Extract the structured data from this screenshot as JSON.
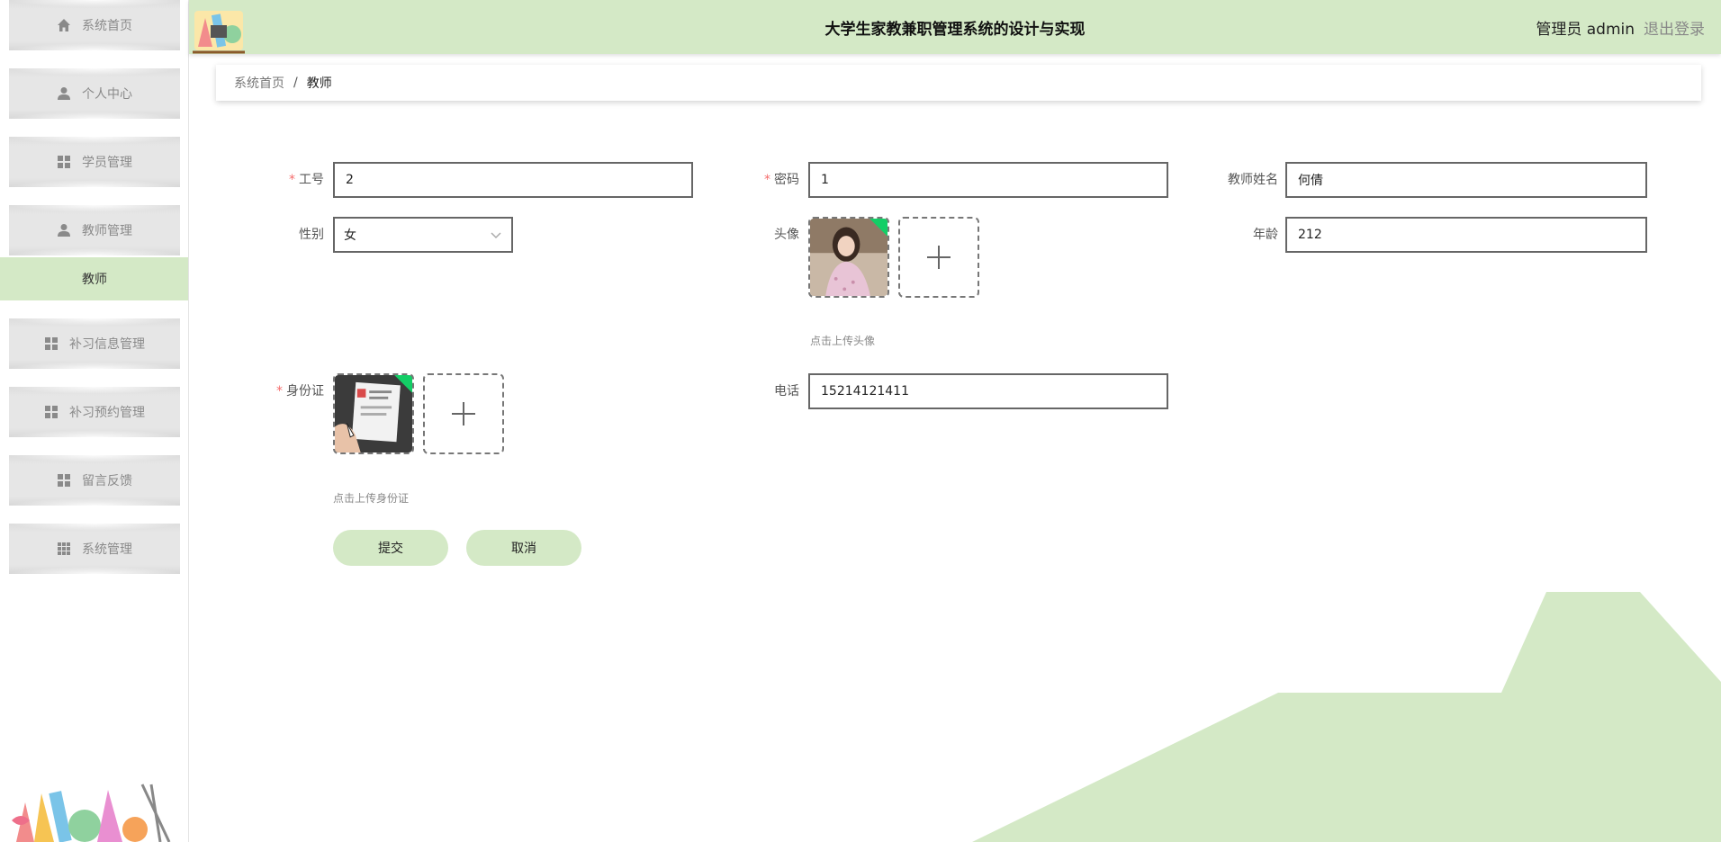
{
  "header": {
    "title": "大学生家教兼职管理系统的设计与实现",
    "user": "管理员 admin",
    "logout": "退出登录"
  },
  "sidebar": {
    "items": [
      {
        "label": "系统首页",
        "icon": "home-icon"
      },
      {
        "label": "个人中心",
        "icon": "user-icon"
      },
      {
        "label": "学员管理",
        "icon": "grid-icon"
      },
      {
        "label": "教师管理",
        "icon": "user-icon"
      },
      {
        "label": "补习信息管理",
        "icon": "grid-icon"
      },
      {
        "label": "补习预约管理",
        "icon": "grid-icon"
      },
      {
        "label": "留言反馈",
        "icon": "grid-icon"
      },
      {
        "label": "系统管理",
        "icon": "apps-icon"
      }
    ],
    "active_subitem": "教师"
  },
  "breadcrumb": {
    "home": "系统首页",
    "separator": "/",
    "current": "教师"
  },
  "form": {
    "employee_id": {
      "label": "工号",
      "value": "2",
      "required": true
    },
    "password": {
      "label": "密码",
      "value": "1",
      "required": true
    },
    "teacher_name": {
      "label": "教师姓名",
      "value": "何倩",
      "required": false
    },
    "gender": {
      "label": "性别",
      "value": "女",
      "required": false
    },
    "avatar": {
      "label": "头像",
      "hint": "点击上传头像",
      "required": false
    },
    "age": {
      "label": "年龄",
      "value": "212",
      "required": false
    },
    "id_card": {
      "label": "身份证",
      "hint": "点击上传身份证",
      "required": true
    },
    "phone": {
      "label": "电话",
      "value": "15214121411",
      "required": false
    },
    "submit": "提交",
    "cancel": "取消"
  },
  "colors": {
    "accent": "#d4e9c6",
    "required": "#f56c6c",
    "upload_success": "#13ce66"
  }
}
